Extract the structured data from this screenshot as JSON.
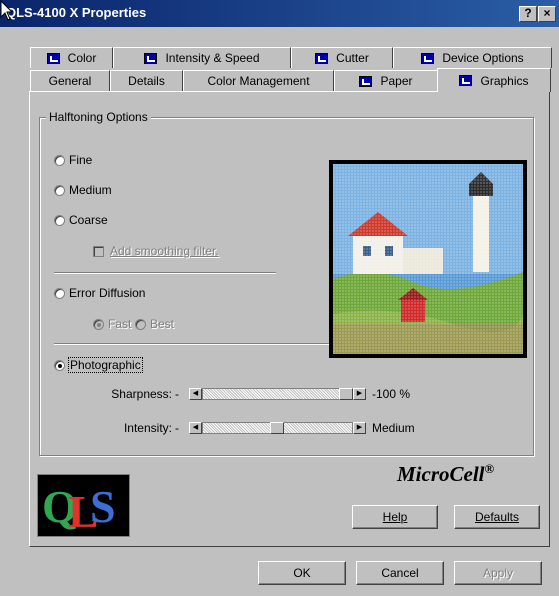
{
  "window": {
    "title": "QLS-4100 X Properties",
    "help_btn": "?",
    "close_btn": "×"
  },
  "tabs_back": [
    {
      "label": "Color",
      "icon": "tab-page-icon"
    },
    {
      "label": "Intensity & Speed",
      "icon": "tab-page-icon"
    },
    {
      "label": "Cutter",
      "icon": "tab-page-icon"
    },
    {
      "label": "Device Options",
      "icon": "tab-page-icon"
    }
  ],
  "tabs_front": [
    {
      "label": "General"
    },
    {
      "label": "Details"
    },
    {
      "label": "Color Management"
    },
    {
      "label": "Paper",
      "icon": "tab-page-icon"
    },
    {
      "label": "Graphics",
      "icon": "tab-page-icon",
      "active": true
    }
  ],
  "halftoning": {
    "group_title": "Halftoning Options",
    "fine": "Fine",
    "medium": "Medium",
    "coarse": "Coarse",
    "smoothing": "Add smoothing filter.",
    "error_diffusion": "Error Diffusion",
    "fast": "Fast",
    "best": "Best",
    "photographic": "Photographic",
    "selected": "Photographic"
  },
  "sliders": {
    "sharpness_label": "Sharpness:",
    "sharpness_value": "-100 %",
    "sharpness_level": 1.0,
    "intensity_label": "Intensity:",
    "intensity_value": "Medium",
    "intensity_level": 0.5,
    "dash": "-"
  },
  "brand": {
    "name": "MicroCell",
    "mark": "®",
    "logo_text": "QLS"
  },
  "buttons": {
    "help": "Help",
    "defaults": "Defaults",
    "ok": "OK",
    "cancel": "Cancel",
    "apply": "Apply"
  },
  "colors": {
    "title_start": "#0a246a",
    "title_end": "#2a5ea6",
    "face": "#c0c0c0"
  }
}
